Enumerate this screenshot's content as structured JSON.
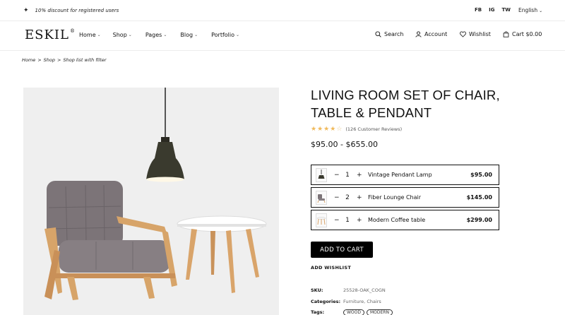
{
  "topbar": {
    "promo_text": "10% discount for registered users",
    "socials": [
      "FB",
      "IG",
      "TW"
    ],
    "language": "English"
  },
  "header": {
    "logo": "ESKIL",
    "logo_mark": "®",
    "nav": [
      {
        "label": "Home"
      },
      {
        "label": "Shop"
      },
      {
        "label": "Pages"
      },
      {
        "label": "Blog"
      },
      {
        "label": "Portfolio"
      }
    ],
    "utilities": {
      "search": "Search",
      "account": "Account",
      "wishlist": "Wishlist",
      "cart": "Cart $0.00"
    }
  },
  "breadcrumb": [
    "Home",
    ">",
    "Shop",
    ">",
    "Shop list with filter"
  ],
  "product": {
    "title_line1": "LIVING ROOM SET OF CHAIR,",
    "title_line2": "TABLE & PENDANT",
    "rating": 4,
    "rating_max": 5,
    "reviews": "(126 Customer Reviews)",
    "price_range": "$95.00 - $655.00",
    "bundle": [
      {
        "qty": "1",
        "name": "Vintage Pendant Lamp",
        "price": "$95.00",
        "icon": "pendant-lamp-thumb"
      },
      {
        "qty": "2",
        "name": "Fiber Lounge Chair",
        "price": "$145.00",
        "icon": "lounge-chair-thumb"
      },
      {
        "qty": "1",
        "name": "Modern Coffee table",
        "price": "$299.00",
        "icon": "coffee-table-thumb"
      }
    ],
    "add_to_cart": "ADD TO CART",
    "add_wishlist": "ADD WISHLIST",
    "sku_label": "SKU:",
    "sku": "25528-OAK_COGN",
    "categories_label": "Categories:",
    "categories": "Furniture, Chairs",
    "tags_label": "Tags:",
    "tags": [
      "WOOD",
      "MODERN"
    ]
  },
  "colors": {
    "accent": "#000000",
    "star": "#f0b95a",
    "image_bg": "#efefef"
  }
}
